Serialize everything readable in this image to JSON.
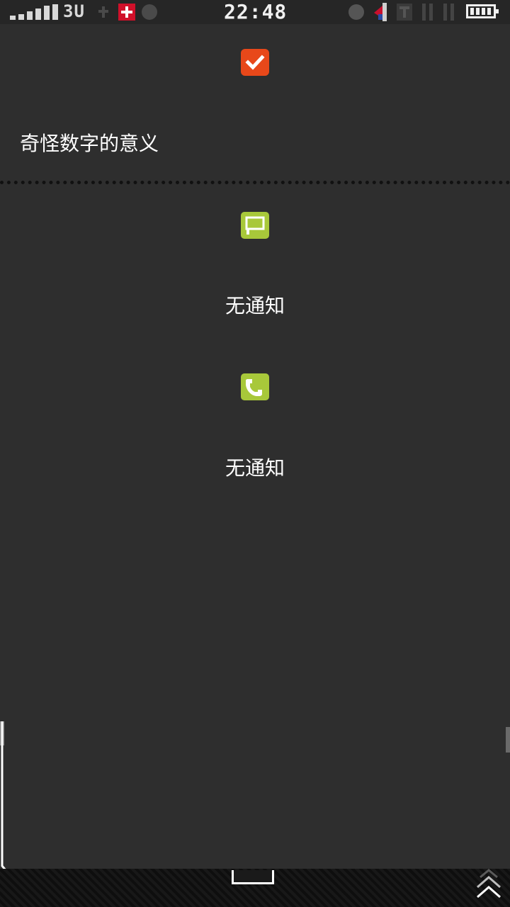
{
  "status_bar": {
    "network_type": "3U",
    "time": "22:48",
    "battery_icon": "battery-full-icon",
    "signal_icon": "signal-strength-icon"
  },
  "task": {
    "icon": "checkbox-check-icon",
    "icon_color": "#e8481a",
    "title": "奇怪数字的意义"
  },
  "messages": {
    "icon": "message-bubble-icon",
    "icon_color": "#a8c83a",
    "text": "无通知"
  },
  "calls": {
    "icon": "phone-icon",
    "icon_color": "#a8c83a",
    "text": "无通知"
  },
  "colors": {
    "background": "#2e2e2e",
    "text": "#ffffff"
  }
}
